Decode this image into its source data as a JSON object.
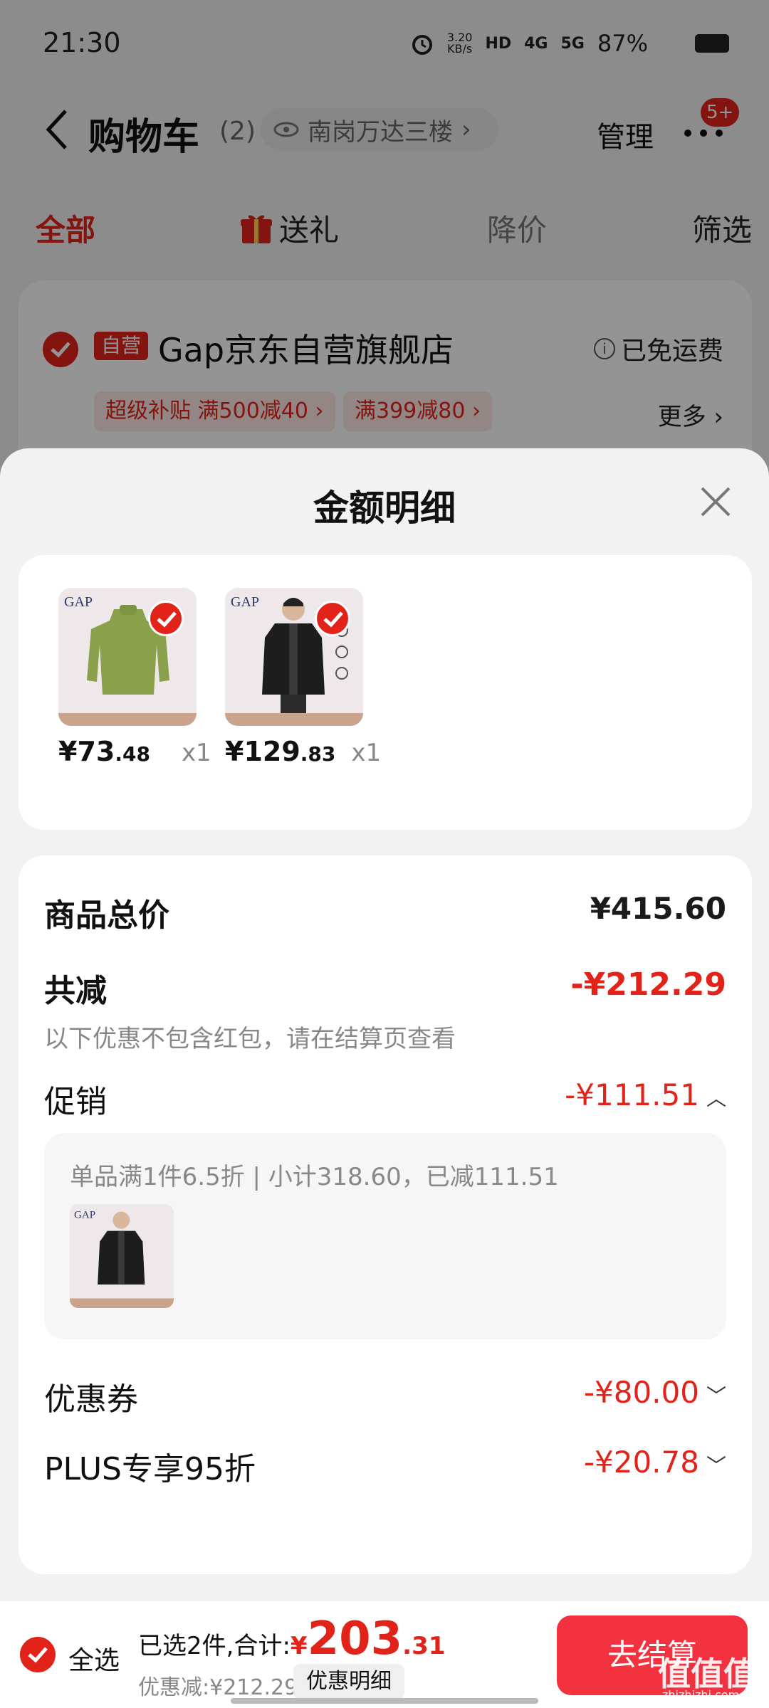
{
  "status_bar": {
    "time": "21:30",
    "net_speed_top": "3.20",
    "net_speed_bottom": "KB/s",
    "hd": "HD",
    "net4g": "4G",
    "net5g": "5G",
    "battery": "87%"
  },
  "nav": {
    "back_icon": "back-chevron-icon",
    "title": "购物车",
    "count": "(2)",
    "location": "南岗万达三楼",
    "manage": "管理",
    "more_badge": "5+"
  },
  "tabs": [
    "全部",
    "送礼",
    "降价",
    "筛选"
  ],
  "store": {
    "self_tag": "自营",
    "name": "Gap京东自营旗舰店",
    "free_shipping": "已免运费",
    "promos": [
      "超级补贴 满500减40 ›",
      "满399减80 ›"
    ],
    "more": "更多 ›"
  },
  "sheet": {
    "title": "金额明细",
    "items": [
      {
        "price_main": "¥73",
        "price_dec": ".48",
        "qty": "x1",
        "thumb_color": "#8aa04a"
      },
      {
        "price_main": "¥129",
        "price_dec": ".83",
        "qty": "x1",
        "thumb_color": "#1d1d1d"
      }
    ],
    "summary": {
      "total_label": "商品总价",
      "total_value": "¥415.60",
      "reduce_label": "共减",
      "reduce_value": "-¥212.29",
      "reduce_note": "以下优惠不包含红包，请在结算页查看",
      "promo_label": "促销",
      "promo_value": "-¥111.51",
      "promo_desc": "单品满1件6.5折 | 小计318.60，已减111.51",
      "coupon_label": "优惠券",
      "coupon_value": "-¥80.00",
      "plus_label": "PLUS专享95折",
      "plus_value": "-¥20.78"
    }
  },
  "bottom_bar": {
    "select_all": "全选",
    "selected_text": "已选2件,合计:",
    "yen": "¥",
    "total_int": "203",
    "total_dec": ".31",
    "discount": "优惠减:¥212.29",
    "detail": "优惠明细",
    "checkout": "去结算"
  },
  "watermark": {
    "main": "值值值",
    "sub": "zhizhizhi.com"
  },
  "colors": {
    "accent": "#e2231a",
    "checkout": "#f2323f"
  }
}
